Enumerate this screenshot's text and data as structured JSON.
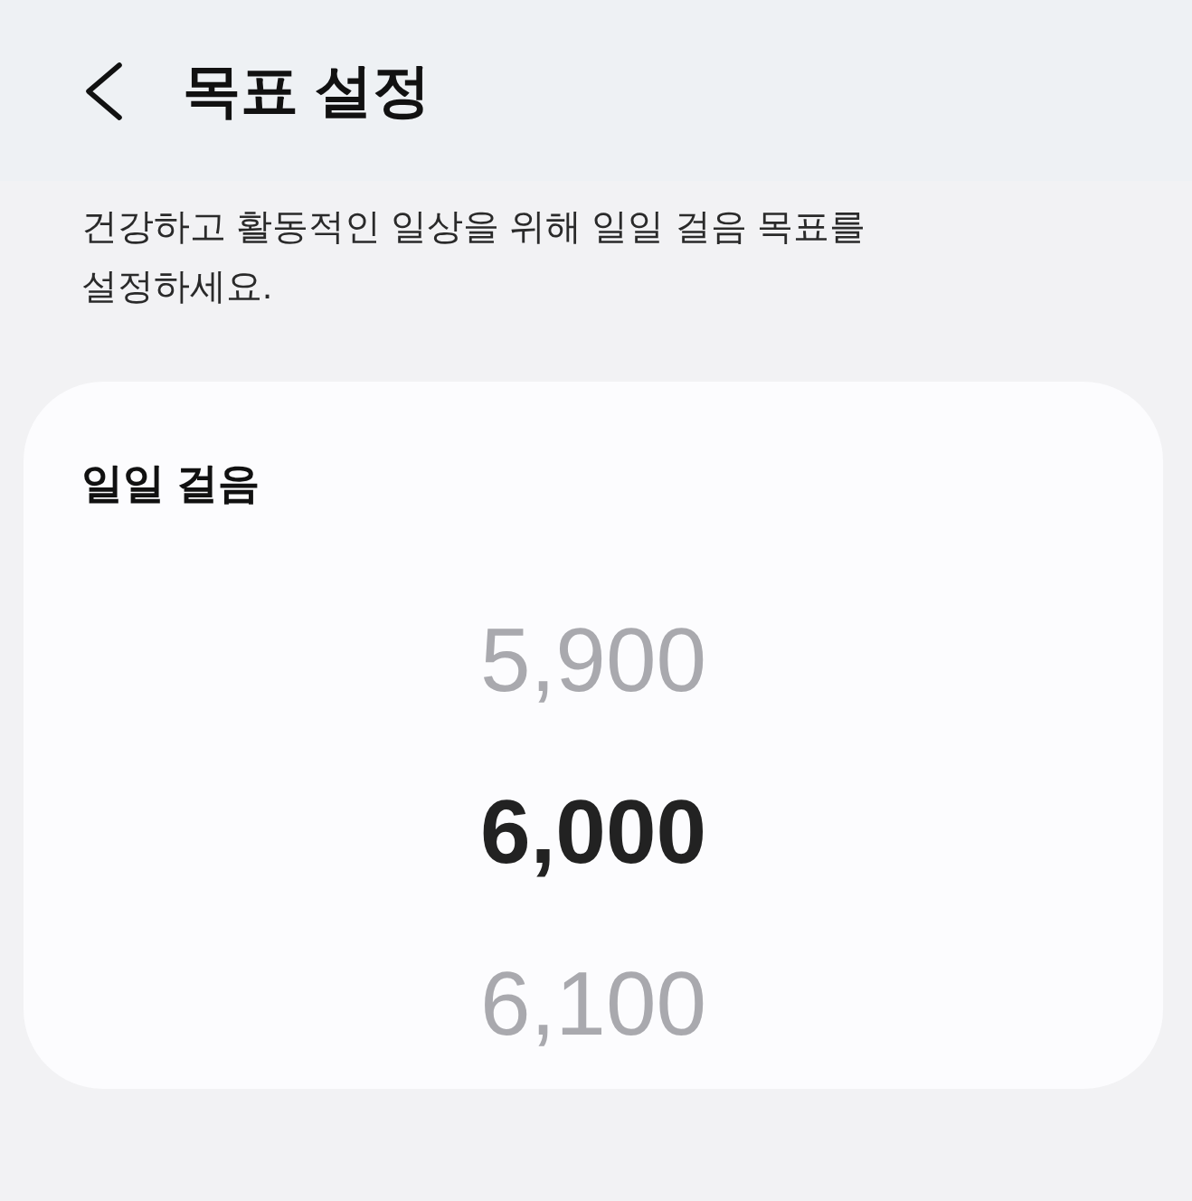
{
  "header": {
    "title": "목표 설정"
  },
  "description": "건강하고 활동적인 일상을 위해 일일 걸음 목표를 설정하세요.",
  "card": {
    "label": "일일 걸음",
    "picker": [
      {
        "value": "5,900",
        "selected": false
      },
      {
        "value": "6,000",
        "selected": true
      },
      {
        "value": "6,100",
        "selected": false
      }
    ]
  }
}
